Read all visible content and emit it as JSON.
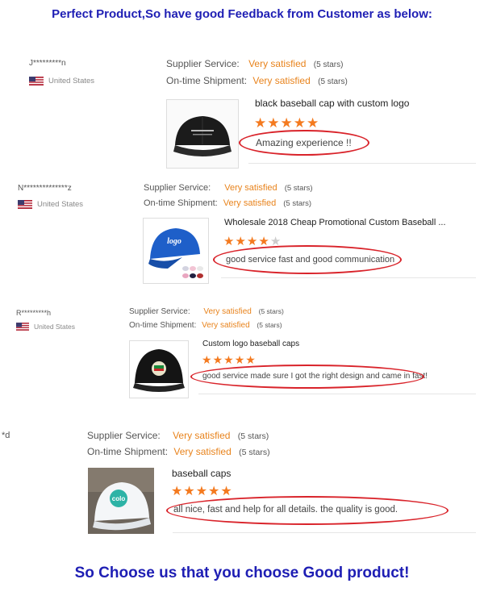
{
  "headline_top": "Perfect Product,So have good Feedback from Customer as below:",
  "headline_bottom": "So Choose us that you choose Good product!",
  "colors": {
    "headline": "#1e1eb4",
    "rating_value": "#e8831c",
    "stars": "#f47a1f",
    "highlight_oval": "#d9232a"
  },
  "labels": {
    "supplier_service": "Supplier Service:",
    "ontime_shipment": "On-time Shipment:"
  },
  "reviews": [
    {
      "buyer": "J*********n",
      "country": "United States",
      "supplier_service": "Very satisfied",
      "supplier_stars": "(5 stars)",
      "shipment": "Very satisfied",
      "shipment_stars": "(5 stars)",
      "product": "black baseball cap with custom logo",
      "rating": 5,
      "comment": "Amazing experience !!",
      "image": "black-cap-image"
    },
    {
      "buyer": "N**************z",
      "country": "United States",
      "supplier_service": "Very satisfied",
      "supplier_stars": "(5 stars)",
      "shipment": "Very satisfied",
      "shipment_stars": "(5 stars)",
      "product": "Wholesale 2018 Cheap Promotional Custom Baseball ...",
      "rating": 4,
      "comment": "good service fast and good communication",
      "image": "blue-cap-image",
      "image_text": "logo"
    },
    {
      "buyer": "R*********h",
      "country": "United States",
      "supplier_service": "Very satisfied",
      "supplier_stars": "(5 stars)",
      "shipment": "Very satisfied",
      "shipment_stars": "(5 stars)",
      "product": "Custom logo baseball caps",
      "rating": 5,
      "comment": "good service made sure I got the right design and came in fast!",
      "image": "black-cap-embroidered-image"
    },
    {
      "buyer": "*d",
      "supplier_service": "Very satisfied",
      "supplier_stars": "(5 stars)",
      "shipment": "Very satisfied",
      "shipment_stars": "(5 stars)",
      "product": "baseball caps",
      "rating": 5,
      "comment": "all nice, fast and help for all details. the quality is good.",
      "image": "white-cap-image",
      "image_text": "colo"
    }
  ]
}
